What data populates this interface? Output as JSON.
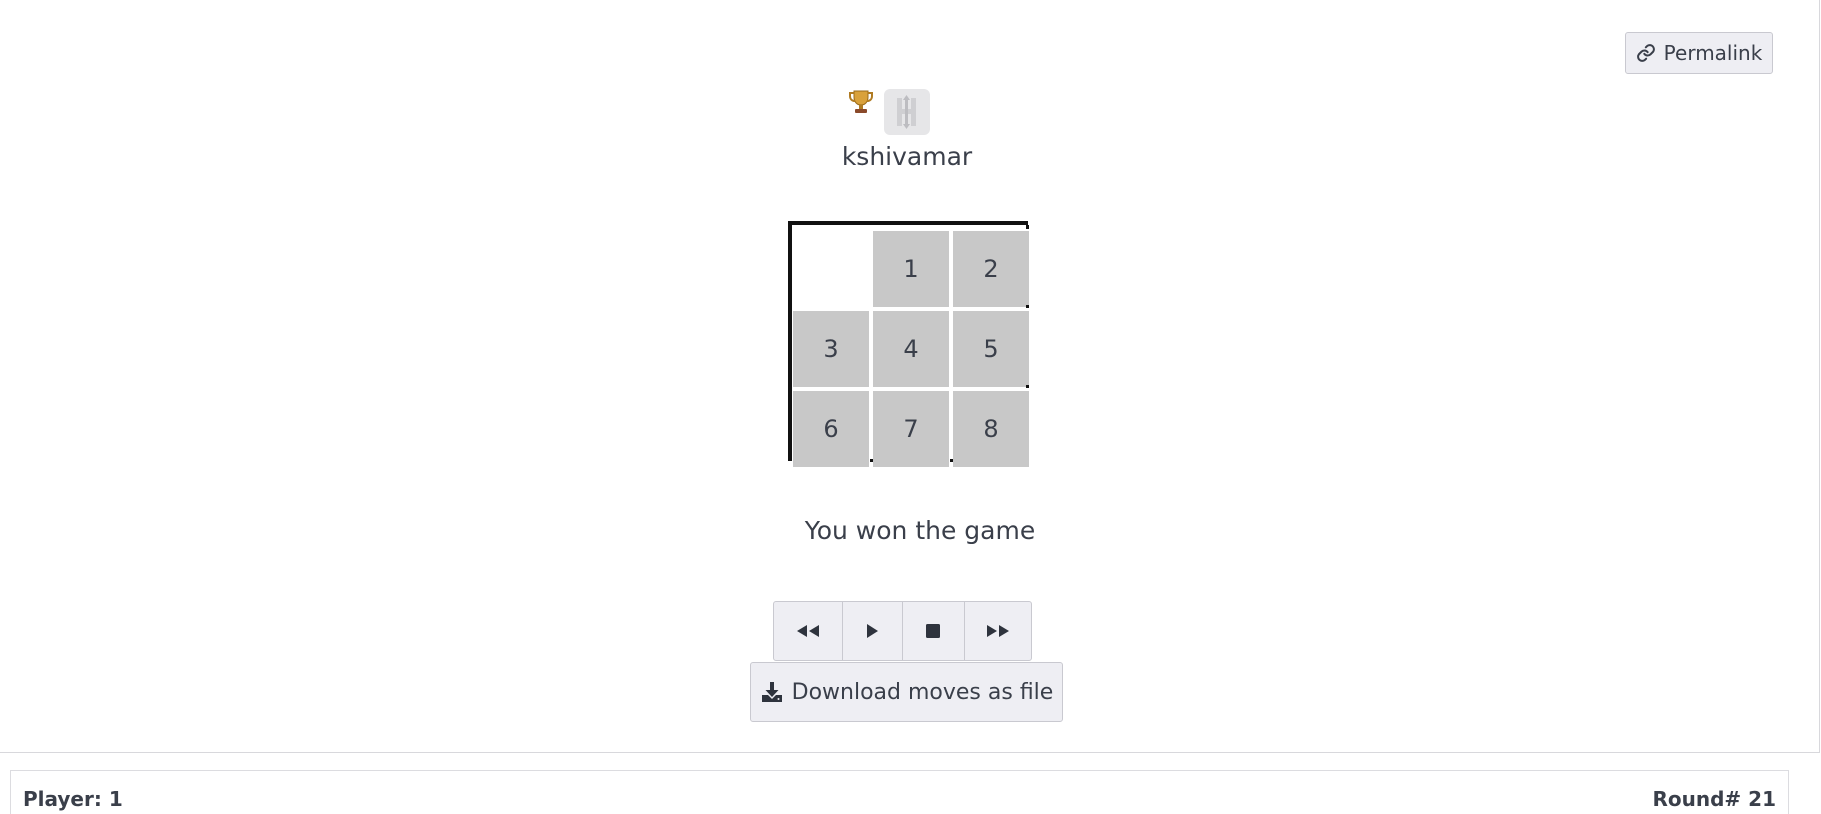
{
  "header": {
    "permalink_label": "Permalink",
    "permalink_icon": "link-icon"
  },
  "player_card": {
    "trophy_icon": "trophy-icon",
    "avatar_icon": "h-arrow-logo-icon",
    "username": "kshivamar"
  },
  "board": {
    "rows": 3,
    "cols": 3,
    "tiles": [
      "",
      "1",
      "2",
      "3",
      "4",
      "5",
      "6",
      "7",
      "8"
    ],
    "tile_color": "#c8c8c8"
  },
  "status": {
    "message": "You won the game"
  },
  "playback": {
    "buttons": [
      {
        "name": "rewind",
        "icon": "fast-backward-icon"
      },
      {
        "name": "play",
        "icon": "play-icon"
      },
      {
        "name": "stop",
        "icon": "stop-icon"
      },
      {
        "name": "fast-forward",
        "icon": "fast-forward-icon"
      }
    ]
  },
  "download": {
    "label": "Download moves as file",
    "icon": "download-icon"
  },
  "footer": {
    "player_label": "Player: 1",
    "round_label": "Round# 21"
  }
}
